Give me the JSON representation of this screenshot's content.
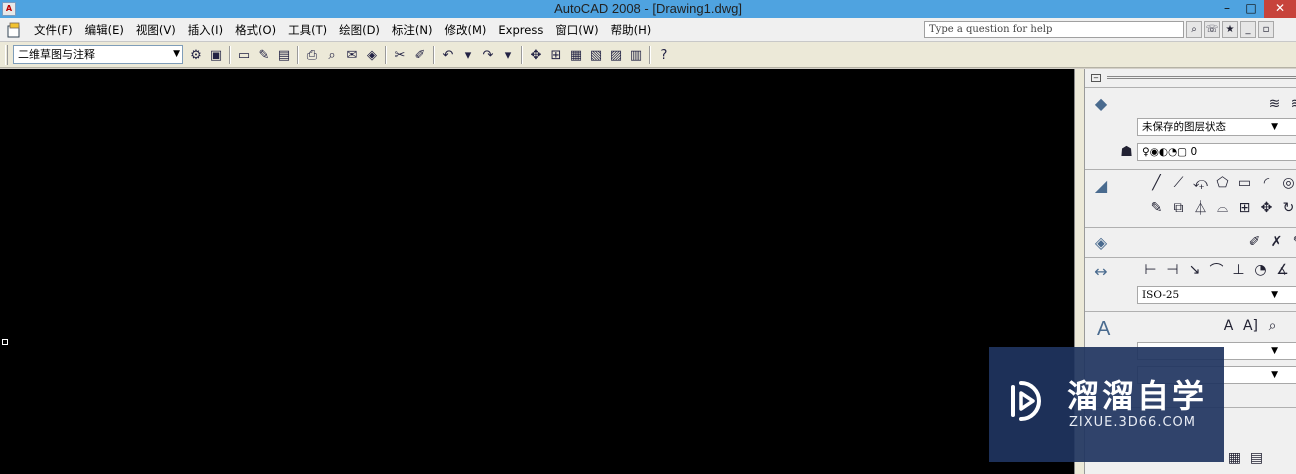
{
  "window": {
    "title": "AutoCAD 2008 - [Drawing1.dwg]",
    "app_icon_text": "A",
    "minimize_glyph": "–",
    "maximize_glyph": "□",
    "close_glyph": "✕"
  },
  "menu": {
    "items": [
      "文件(F)",
      "编辑(E)",
      "视图(V)",
      "插入(I)",
      "格式(O)",
      "工具(T)",
      "绘图(D)",
      "标注(N)",
      "修改(M)",
      "Express",
      "窗口(W)",
      "帮助(H)"
    ],
    "help_placeholder": "Type a question for help"
  },
  "toolbar": {
    "workspace": "二维草图与注释"
  },
  "palette": {
    "layer_state": "未保存的图层状态",
    "current_layer": "0",
    "dim_style": "ISO-25",
    "big_a_glyph": "A",
    "text_tools": [
      "A",
      "A]"
    ]
  },
  "watermark": {
    "name": "溜溜自学",
    "url": "ZIXUE.3D66.COM"
  },
  "colors": {
    "titlebar": "#4fa3e0",
    "canvas": "#000000",
    "close_button": "#c7433b",
    "watermark_bg": "#203460"
  }
}
